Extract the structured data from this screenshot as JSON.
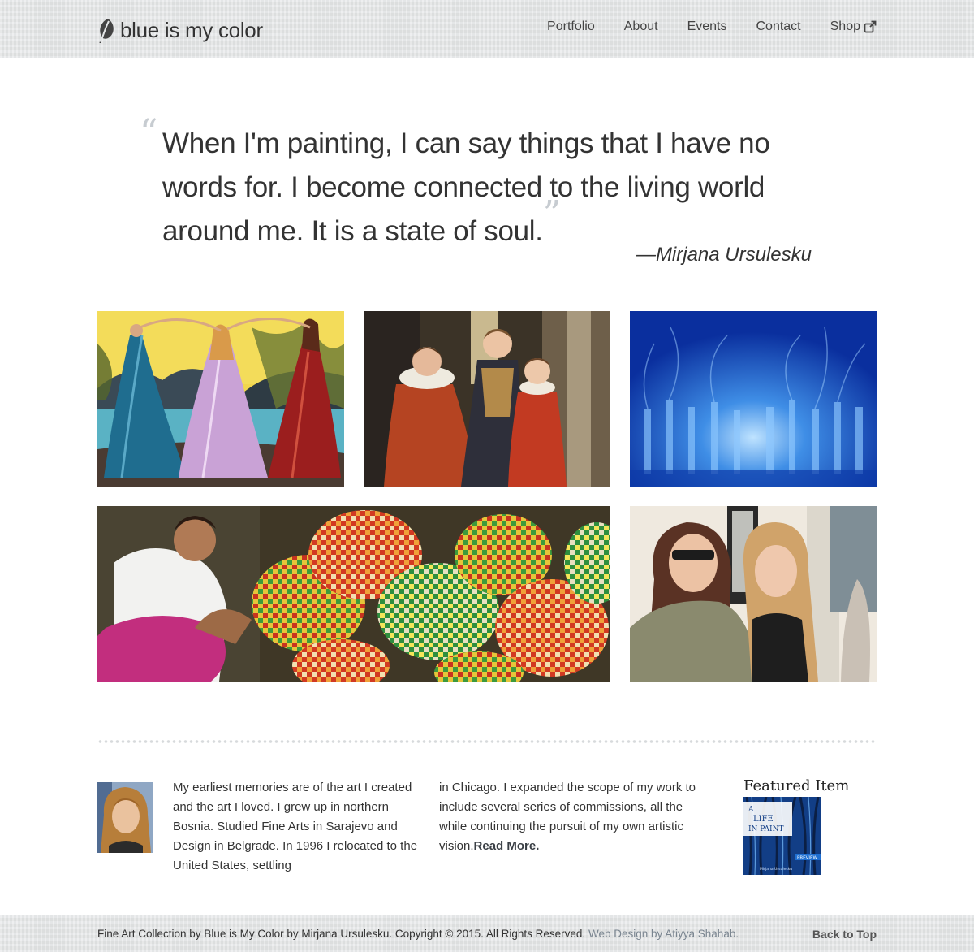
{
  "header": {
    "logo_text": "blue is my color",
    "logo_icon": "leaf-icon",
    "nav": [
      {
        "label": "Portfolio"
      },
      {
        "label": "About"
      },
      {
        "label": "Events"
      },
      {
        "label": "Contact"
      },
      {
        "label": "Shop",
        "icon": "external-link-icon"
      }
    ]
  },
  "quote": {
    "text": "When I'm painting, I can say things that I have no words for. I become connected to the living world around me. It is a state of soul.",
    "author": "—Mirjana Ursulesku"
  },
  "gallery": [
    {
      "subject": "three women dancing in gowns painting"
    },
    {
      "subject": "three children in period costume painting"
    },
    {
      "subject": "blue forest painting"
    },
    {
      "subject": "woman weaving colorful baskets painting"
    },
    {
      "subject": "photo of two women smiling at gallery"
    }
  ],
  "bio": {
    "avatar": "artist-portrait",
    "col1": "My earliest memories are of the art I created and the art I loved. I grew up in northern Bosnia. Studied Fine Arts in Sarajevo and Design in Belgrade. In 1996 I relocated to the United States, settling",
    "col2": "in Chicago. I expanded the scope of my work to include several series of commissions, all the while continuing the pursuit of my own artistic vision.",
    "read_more": "Read More."
  },
  "featured": {
    "title": "Featured Item",
    "book_title_line1": "A",
    "book_title_line2": "LIFE",
    "book_title_line3": "IN PAINT",
    "book_badge": "PREVIEW",
    "book_author": "Mirjana Ursulesku"
  },
  "footer": {
    "copyright": "Fine Art Collection by Blue is My Color by Mirjana Ursulesku. Copyright © 2015. All Rights Reserved.",
    "credit": "Web Design by Atiyya Shahab.",
    "back_to_top": "Back to Top"
  },
  "colors": {
    "header_bg": "#e3e5e6",
    "quote_mark": "#c7ccd1",
    "text": "#333333",
    "link_muted": "#7a8590"
  }
}
